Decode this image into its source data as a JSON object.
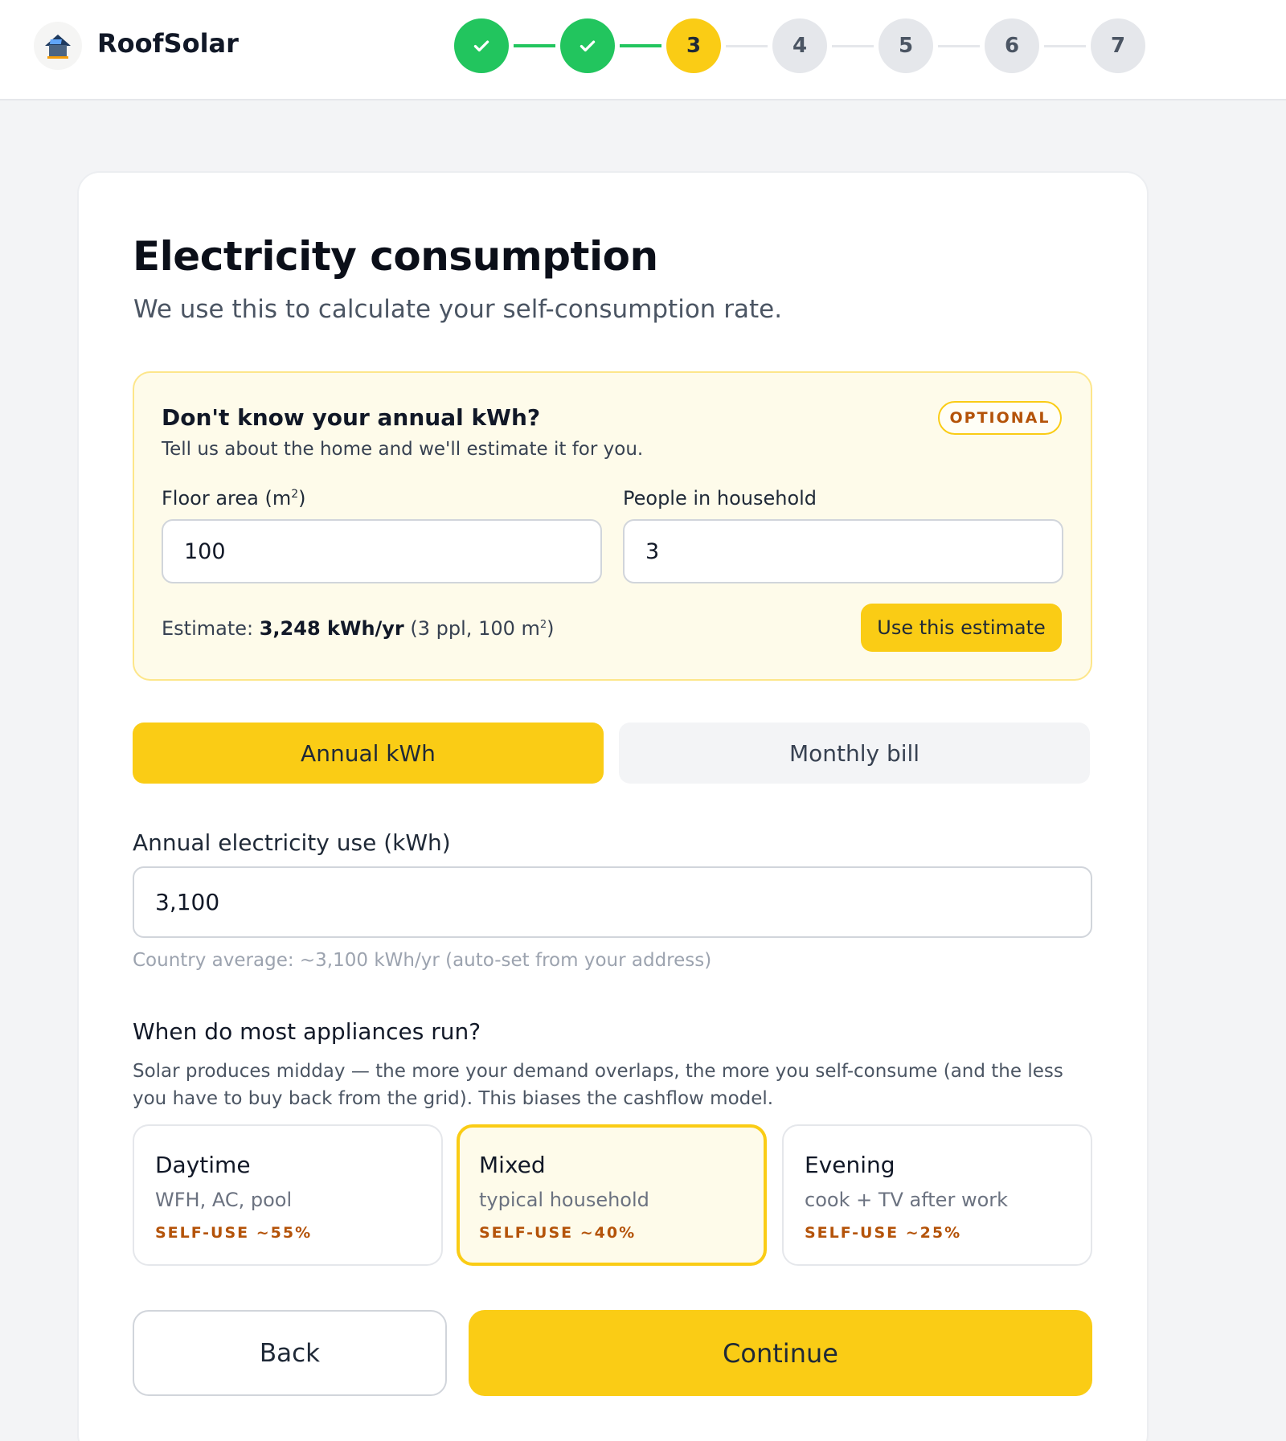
{
  "header": {
    "brand": "RoofSolar",
    "logo_icon": "house-solar-logo-icon",
    "steps": [
      {
        "label": "",
        "state": "done",
        "icon": "check-icon"
      },
      {
        "label": "",
        "state": "done",
        "icon": "check-icon"
      },
      {
        "label": "3",
        "state": "current"
      },
      {
        "label": "4",
        "state": "todo"
      },
      {
        "label": "5",
        "state": "todo"
      },
      {
        "label": "6",
        "state": "todo"
      },
      {
        "label": "7",
        "state": "todo"
      }
    ]
  },
  "page": {
    "title": "Electricity consumption",
    "subtitle": "We use this to calculate your self-consumption rate."
  },
  "estimate": {
    "question": "Don't know your annual kWh?",
    "description": "Tell us about the home and we'll estimate it for you.",
    "badge": "OPTIONAL",
    "floor_label": "Floor area (m",
    "floor_sup": "2",
    "floor_label_end": ")",
    "floor_value": "100",
    "people_label": "People in household",
    "people_value": "3",
    "result_prefix": "Estimate: ",
    "result_value": "3,248 kWh/yr",
    "result_detail": " (3 ppl, 100 m",
    "result_sup": "2",
    "result_end": ")",
    "use_button": "Use this estimate"
  },
  "mode_toggle": {
    "annual": "Annual kWh",
    "monthly": "Monthly bill",
    "selected": "annual"
  },
  "annual": {
    "label": "Annual electricity use (kWh)",
    "value": "3,100",
    "hint": "Country average: ~3,100 kWh/yr (auto-set from your address)"
  },
  "appliances": {
    "question": "When do most appliances run?",
    "description": "Solar produces midday — the more your demand overlaps, the more you self-consume (and the less you have to buy back from the grid). This biases the cashflow model.",
    "options": [
      {
        "title": "Daytime",
        "desc": "WFH, AC, pool",
        "rate": "SELF-USE ~55%",
        "selected": false
      },
      {
        "title": "Mixed",
        "desc": "typical household",
        "rate": "SELF-USE ~40%",
        "selected": true
      },
      {
        "title": "Evening",
        "desc": "cook + TV after work",
        "rate": "SELF-USE ~25%",
        "selected": false
      }
    ]
  },
  "nav": {
    "back": "Back",
    "continue": "Continue"
  },
  "colors": {
    "accent": "#facc15",
    "done": "#22c55e",
    "todo": "#e5e7eb",
    "rate_text": "#b45309"
  }
}
